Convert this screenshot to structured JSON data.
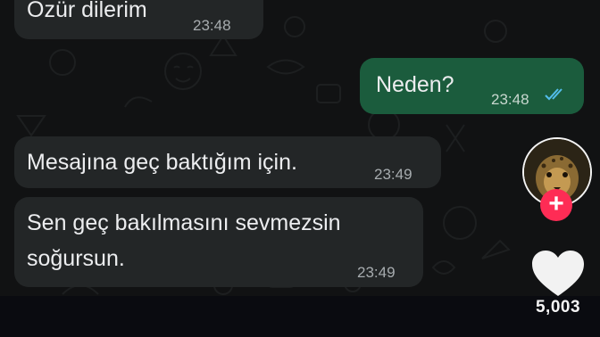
{
  "messages": [
    {
      "direction": "incoming",
      "text": "Özür dilerim",
      "time": "23:48"
    },
    {
      "direction": "outgoing",
      "text": "Neden?",
      "time": "23:48",
      "status": "read"
    },
    {
      "direction": "incoming",
      "text": "Mesajına geç baktığım için.",
      "time": "23:49"
    },
    {
      "direction": "incoming",
      "text_lines": [
        "Sen geç bakılmasını sevmezsin",
        "soğursun."
      ],
      "time": "23:49"
    }
  ],
  "overlay": {
    "follow_symbol": "+",
    "like_count": "5,003",
    "icons": [
      "avatar",
      "follow-plus-icon",
      "heart-icon"
    ]
  },
  "colors": {
    "incoming_bubble": "#232627",
    "outgoing_bubble": "#1b5c3d",
    "read_ticks": "#53bdeb",
    "follow_button": "#fe2c55",
    "chat_background": "#111213"
  }
}
